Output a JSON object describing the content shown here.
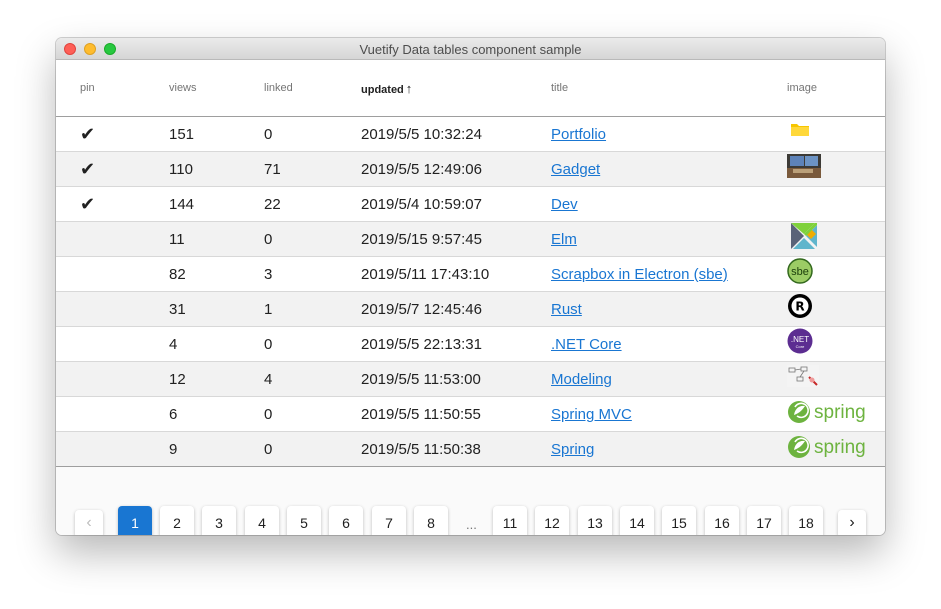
{
  "window": {
    "title": "Vuetify Data tables component sample"
  },
  "table": {
    "headers": {
      "pin": "pin",
      "views": "views",
      "linked": "linked",
      "updated": "updated",
      "title": "title",
      "image": "image"
    },
    "sort": {
      "column": "updated",
      "direction": "ascending",
      "arrow": "↑"
    },
    "rows": [
      {
        "pin": "✔",
        "views": "151",
        "linked": "0",
        "updated": "2019/5/5 10:32:24",
        "title": "Portfolio",
        "image": "folder-icon"
      },
      {
        "pin": "✔",
        "views": "110",
        "linked": "71",
        "updated": "2019/5/5 12:49:06",
        "title": "Gadget",
        "image": "gadget-photo"
      },
      {
        "pin": "✔",
        "views": "144",
        "linked": "22",
        "updated": "2019/5/4 10:59:07",
        "title": "Dev",
        "image": ""
      },
      {
        "pin": "",
        "views": "11",
        "linked": "0",
        "updated": "2019/5/15 9:57:45",
        "title": "Elm",
        "image": "elm-logo"
      },
      {
        "pin": "",
        "views": "82",
        "linked": "3",
        "updated": "2019/5/11 17:43:10",
        "title": "Scrapbox in Electron (sbe)",
        "image": "sbe-logo"
      },
      {
        "pin": "",
        "views": "31",
        "linked": "1",
        "updated": "2019/5/7 12:45:46",
        "title": "Rust",
        "image": "rust-logo"
      },
      {
        "pin": "",
        "views": "4",
        "linked": "0",
        "updated": "2019/5/5 22:13:31",
        "title": ".NET Core",
        "image": "dotnet-logo"
      },
      {
        "pin": "",
        "views": "12",
        "linked": "4",
        "updated": "2019/5/5 11:53:00",
        "title": "Modeling",
        "image": "modeling-sketch"
      },
      {
        "pin": "",
        "views": "6",
        "linked": "0",
        "updated": "2019/5/5 11:50:55",
        "title": "Spring MVC",
        "image": "spring-logo"
      },
      {
        "pin": "",
        "views": "9",
        "linked": "0",
        "updated": "2019/5/5 11:50:38",
        "title": "Spring",
        "image": "spring-logo"
      }
    ]
  },
  "logos": {
    "sbe_text": "sbe",
    "dotnet_text": ".NET",
    "dotnet_sub": "Core",
    "spring_text": "spring"
  },
  "pagination": {
    "prev": "‹",
    "next": "›",
    "current": "1",
    "pages_start": [
      "1",
      "2",
      "3",
      "4",
      "5",
      "6",
      "7",
      "8"
    ],
    "ellipsis": "...",
    "pages_end": [
      "11",
      "12",
      "13",
      "14",
      "15",
      "16",
      "17",
      "18"
    ]
  },
  "colors": {
    "link": "#1976d2",
    "active_page": "#1976d2",
    "spring_green": "#6db33f",
    "dotnet_purple": "#5c2d91"
  }
}
